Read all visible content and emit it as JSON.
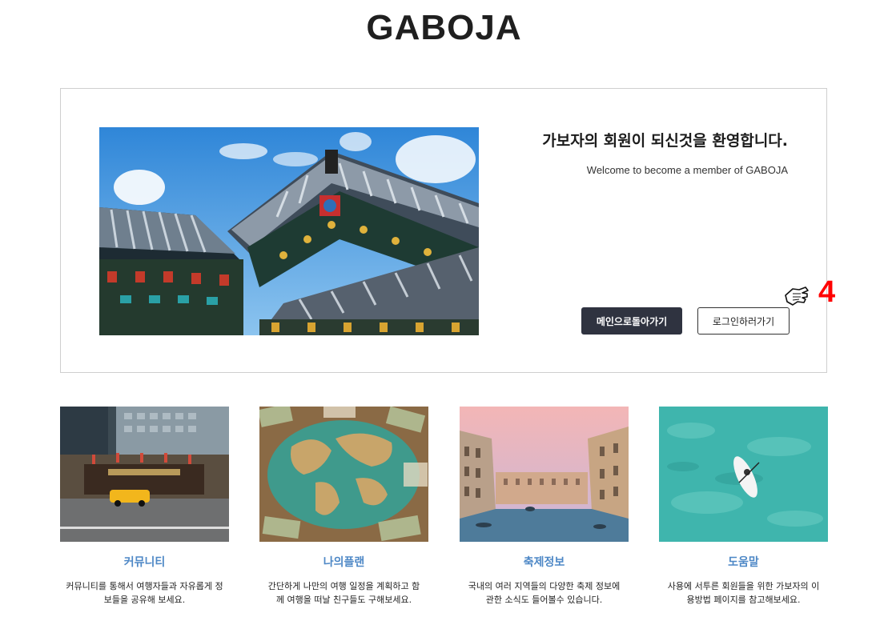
{
  "header": {
    "logo": "GABOJA"
  },
  "welcome": {
    "heading": "가보자의 회원이 되신것을 환영합니다.",
    "subheading": "Welcome to become a member of GABOJA",
    "main_button": "메인으로돌아가기",
    "login_button": "로그인하러가기",
    "hero_image": "hanok-roof-photo"
  },
  "annotation": {
    "step": "4",
    "cursor": "hand-pointer-icon"
  },
  "cards": [
    {
      "title": "커뮤니티",
      "desc_line1": "커뮤니티를 통해서 여행자들과 자유롭게 정",
      "desc_line2": "보들을 공유해 보세요.",
      "image": "korana-hotel-photo"
    },
    {
      "title": "나의플랜",
      "desc_line1": "간단하게 나만의 여행 일정을 계획하고 함",
      "desc_line2": "께 여행을 떠날 친구들도 구해보세요.",
      "image": "world-map-money-photo"
    },
    {
      "title": "축제정보",
      "desc_line1": "국내의 여러 지역들의 다양한 축제 정보에",
      "desc_line2": "관한 소식도 들어볼수 있습니다.",
      "image": "venice-canal-photo"
    },
    {
      "title": "도움말",
      "desc_line1": "사용에 서투른 회원들을 위한 가보자의 이",
      "desc_line2": "용방법 페이지를 참고해보세요.",
      "image": "paddleboard-sea-photo"
    }
  ]
}
